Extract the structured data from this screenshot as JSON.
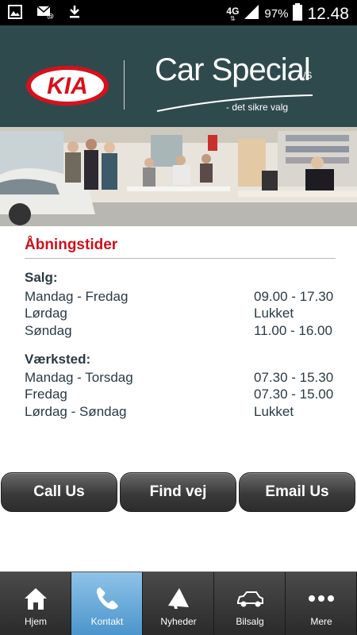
{
  "status_bar": {
    "network": "4G",
    "battery": "97%",
    "time": "12.48"
  },
  "header": {
    "kia_logo_text": "KIA",
    "brand_name": "Car Special",
    "brand_suffix": "A/S",
    "tagline": "- det sikre valg"
  },
  "opening_hours": {
    "title": "Åbningstider",
    "groups": [
      {
        "heading": "Salg:",
        "rows": [
          {
            "day": "Mandag - Fredag",
            "time": "09.00 - 17.30"
          },
          {
            "day": "Lørdag",
            "time": "Lukket"
          },
          {
            "day": "Søndag",
            "time": "11.00 - 16.00"
          }
        ]
      },
      {
        "heading": "Værksted:",
        "rows": [
          {
            "day": "Mandag - Torsdag",
            "time": "07.30 - 15.30"
          },
          {
            "day": "Fredag",
            "time": "07.30 - 15.00"
          },
          {
            "day": "Lørdag - Søndag",
            "time": "Lukket"
          }
        ]
      }
    ]
  },
  "actions": {
    "call": "Call Us",
    "find": "Find vej",
    "email": "Email Us"
  },
  "nav": [
    {
      "label": "Hjem",
      "icon": "home-icon"
    },
    {
      "label": "Kontakt",
      "icon": "phone-icon",
      "active": true
    },
    {
      "label": "Nyheder",
      "icon": "megaphone-icon"
    },
    {
      "label": "Bilsalg",
      "icon": "car-icon"
    },
    {
      "label": "Mere",
      "icon": "more-icon"
    }
  ],
  "colors": {
    "header_bg": "#2f4a4d",
    "title_red": "#d0101c",
    "nav_active": "#4a94cc"
  }
}
